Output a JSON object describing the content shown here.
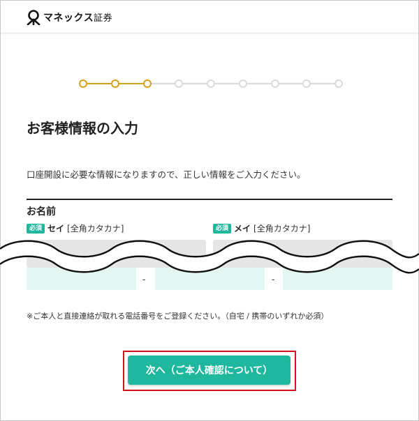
{
  "header": {
    "brand_name": "マネックス",
    "brand_suffix": "証券",
    "logo_icon": "monex-logo-icon"
  },
  "stepper": {
    "total_steps": 9,
    "completed_steps": 3,
    "active_color": "#d4a21a",
    "inactive_color": "#d9d9d9"
  },
  "page": {
    "title": "お客様情報の入力",
    "description": "口座開設に必要な情報になりますので、正しい情報をご入力ください。"
  },
  "name_section": {
    "heading": "お名前",
    "last_name": {
      "required_badge": "必須",
      "label": "セイ",
      "hint": "[全角カタカナ]",
      "value": ""
    },
    "first_name": {
      "required_badge": "必須",
      "label": "メイ",
      "hint": "[全角カタカナ]",
      "value": ""
    }
  },
  "phone_section": {
    "separator": "-",
    "note": "※ご本人と直接連絡が取れる電話番号をご登録ください。（自宅 / 携帯のいずれか必須）"
  },
  "actions": {
    "next_label": "次へ（ご本人確認について）",
    "accent_color": "#1fb79e",
    "highlight_color": "#d0121b"
  }
}
